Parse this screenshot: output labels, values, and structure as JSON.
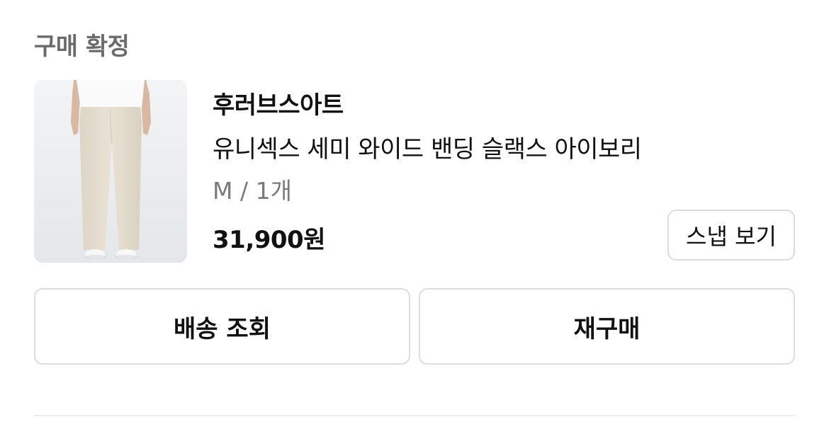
{
  "section": {
    "status": "구매 확정"
  },
  "product": {
    "brand": "후러브스아트",
    "name": "유니섹스 세미 와이드 밴딩 슬랙스 아이보리",
    "option": "M / 1개",
    "price": "31,900원",
    "image_alt": "아이보리 와이드 슬랙스 착용 이미지",
    "snap_button": "스냅 보기"
  },
  "actions": {
    "track_shipping": "배송 조회",
    "reorder": "재구매"
  },
  "colors": {
    "header_text": "#6b6b6b",
    "primary_text": "#111111",
    "muted_text": "#7a7a7a",
    "border": "#dcdcdc",
    "divider": "#ececec",
    "thumb_bg": "#eceff1"
  }
}
